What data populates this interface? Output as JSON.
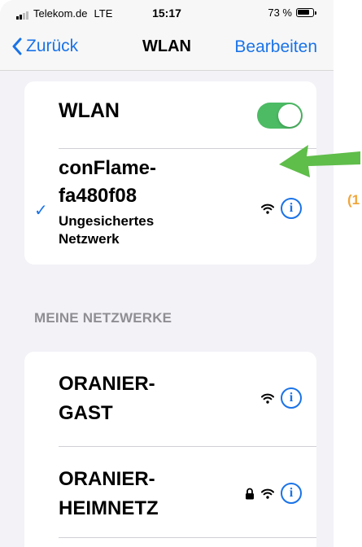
{
  "status": {
    "carrier": "Telekom.de",
    "network": "LTE",
    "time": "15:17",
    "battery": "73 %"
  },
  "nav": {
    "back": "Zurück",
    "title": "WLAN",
    "edit": "Bearbeiten"
  },
  "wlan": {
    "label": "WLAN",
    "enabled": true
  },
  "current": {
    "name_line1": "conFlame-",
    "name_line2": "fa480f08",
    "sub_line1": "Ungesichertes",
    "sub_line2": "Netzwerk",
    "check": "✓",
    "info": "i"
  },
  "section": {
    "header": "MEINE NETZWERKE"
  },
  "networks": [
    {
      "name_line1": "ORANIER-",
      "name_line2": "GAST",
      "locked": false,
      "info": "i"
    },
    {
      "name_line1": "ORANIER-",
      "name_line2": "HEIMNETZ",
      "locked": true,
      "info": "i"
    }
  ],
  "annotation": {
    "number": "(1"
  },
  "colors": {
    "accent": "#1a73e8",
    "toggle_on": "#4cbb64",
    "arrow": "#5fbd4a",
    "annotation": "#f0a63c"
  },
  "icons": [
    "chevron-left-icon",
    "wifi-icon",
    "info-icon",
    "lock-icon",
    "checkmark-icon",
    "battery-icon",
    "signal-icon"
  ]
}
